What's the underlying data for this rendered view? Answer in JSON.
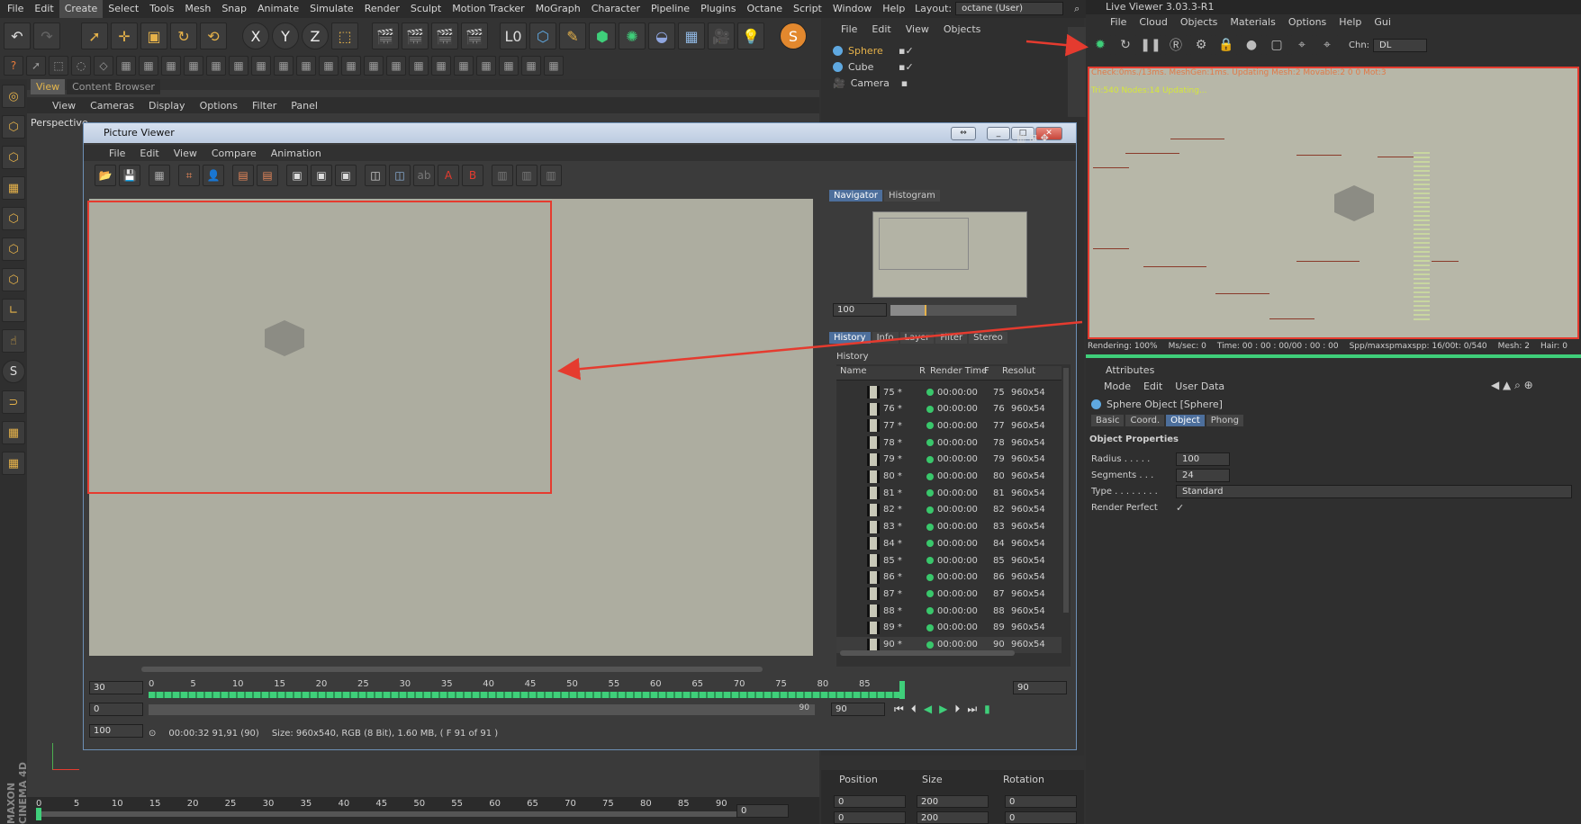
{
  "menubar": [
    "File",
    "Edit",
    "Create",
    "Select",
    "Tools",
    "Mesh",
    "Snap",
    "Animate",
    "Simulate",
    "Render",
    "Sculpt",
    "Motion Tracker",
    "MoGraph",
    "Character",
    "Pipeline",
    "Plugins",
    "Octane",
    "Script",
    "Window",
    "Help"
  ],
  "layout": {
    "label": "Layout:",
    "value": "octane (User)"
  },
  "viewport": {
    "tabs": [
      "View",
      "Content Browser"
    ],
    "menu": [
      "View",
      "Cameras",
      "Display",
      "Options",
      "Filter",
      "Panel"
    ],
    "label": "Perspective"
  },
  "objmgr": {
    "menu": [
      "File",
      "Edit",
      "View",
      "Objects"
    ],
    "objects": [
      "Sphere",
      "Cube",
      "Camera"
    ]
  },
  "pv": {
    "title": "Picture Viewer",
    "menu": [
      "File",
      "Edit",
      "View",
      "Compare",
      "Animation"
    ],
    "navtabs": [
      "Navigator",
      "Histogram"
    ],
    "zoom": "100",
    "histtabs": [
      "History",
      "Info",
      "Layer",
      "Filter",
      "Stereo"
    ],
    "history_label": "History",
    "cols": [
      "Name",
      "R",
      "Render Time",
      "F",
      "Resolut"
    ],
    "rows": [
      {
        "name": "75 *",
        "time": "00:00:00",
        "f": "75",
        "res": "960x54"
      },
      {
        "name": "76 *",
        "time": "00:00:00",
        "f": "76",
        "res": "960x54"
      },
      {
        "name": "77 *",
        "time": "00:00:00",
        "f": "77",
        "res": "960x54"
      },
      {
        "name": "78 *",
        "time": "00:00:00",
        "f": "78",
        "res": "960x54"
      },
      {
        "name": "79 *",
        "time": "00:00:00",
        "f": "79",
        "res": "960x54"
      },
      {
        "name": "80 *",
        "time": "00:00:00",
        "f": "80",
        "res": "960x54"
      },
      {
        "name": "81 *",
        "time": "00:00:00",
        "f": "81",
        "res": "960x54"
      },
      {
        "name": "82 *",
        "time": "00:00:00",
        "f": "82",
        "res": "960x54"
      },
      {
        "name": "83 *",
        "time": "00:00:00",
        "f": "83",
        "res": "960x54"
      },
      {
        "name": "84 *",
        "time": "00:00:00",
        "f": "84",
        "res": "960x54"
      },
      {
        "name": "85 *",
        "time": "00:00:00",
        "f": "85",
        "res": "960x54"
      },
      {
        "name": "86 *",
        "time": "00:00:00",
        "f": "86",
        "res": "960x54"
      },
      {
        "name": "87 *",
        "time": "00:00:00",
        "f": "87",
        "res": "960x54"
      },
      {
        "name": "88 *",
        "time": "00:00:00",
        "f": "88",
        "res": "960x54"
      },
      {
        "name": "89 *",
        "time": "00:00:00",
        "f": "89",
        "res": "960x54"
      },
      {
        "name": "90 *",
        "time": "00:00:00",
        "f": "90",
        "res": "960x54"
      }
    ],
    "timeline_ticks": [
      "0",
      "5",
      "10",
      "15",
      "20",
      "25",
      "30",
      "35",
      "40",
      "45",
      "50",
      "55",
      "60",
      "65",
      "70",
      "75",
      "80",
      "85"
    ],
    "fps": "30",
    "start": "0",
    "end": "90",
    "frame_end": "90",
    "range_end": "90",
    "zoom_bottom": "100",
    "status": "00:00:32 91,91 (90)",
    "info": "Size: 960x540, RGB (8 Bit), 1.60 MB,  ( F 91 of 91 )"
  },
  "main_timeline": {
    "ticks": [
      "0",
      "5",
      "10",
      "15",
      "20",
      "25",
      "30",
      "35",
      "40",
      "45",
      "50",
      "55",
      "60",
      "65",
      "70",
      "75",
      "80",
      "85",
      "90"
    ],
    "frame": "0"
  },
  "coords": {
    "headers": [
      "Position",
      "Size",
      "Rotation"
    ],
    "pos_x": "0",
    "size_x": "200",
    "rot_h": "0",
    "pos_y": "0",
    "size_y": "200",
    "rot_p": "0"
  },
  "lv": {
    "title": "Live Viewer 3.03.3-R1",
    "menu": [
      "File",
      "Cloud",
      "Objects",
      "Materials",
      "Options",
      "Help",
      "Gui"
    ],
    "chn_label": "Chn:",
    "chn": "DL",
    "status1": "Check:0ms./13ms. MeshGen:1ms. Updating Mesh:2 Movable:2  0 0 Mot:3",
    "status2": "Tri:540 Nodes:14  Updating...",
    "stats": [
      "Rendering: 100%",
      "Ms/sec: 0",
      "Time: 00 : 00 : 00/00 : 00 : 00",
      "Spp/maxspmaxspp: 16/00t: 0/540",
      "Mesh: 2",
      "Hair: 0"
    ]
  },
  "attributes": {
    "title": "Attributes",
    "menu": [
      "Mode",
      "Edit",
      "User Data"
    ],
    "object": "Sphere Object [Sphere]",
    "tabs": [
      "Basic",
      "Coord.",
      "Object",
      "Phong"
    ],
    "section": "Object Properties",
    "props": [
      {
        "label": "Radius . . . . .",
        "value": "100"
      },
      {
        "label": "Segments . . .",
        "value": "24"
      },
      {
        "label": "Type . . . . . . . .",
        "value": "Standard"
      },
      {
        "label": "Render Perfect",
        "value": "✓"
      }
    ]
  },
  "colors": {
    "annotation": "#e53b2f",
    "accent": "#e6b24a",
    "ok": "#39c76b"
  }
}
